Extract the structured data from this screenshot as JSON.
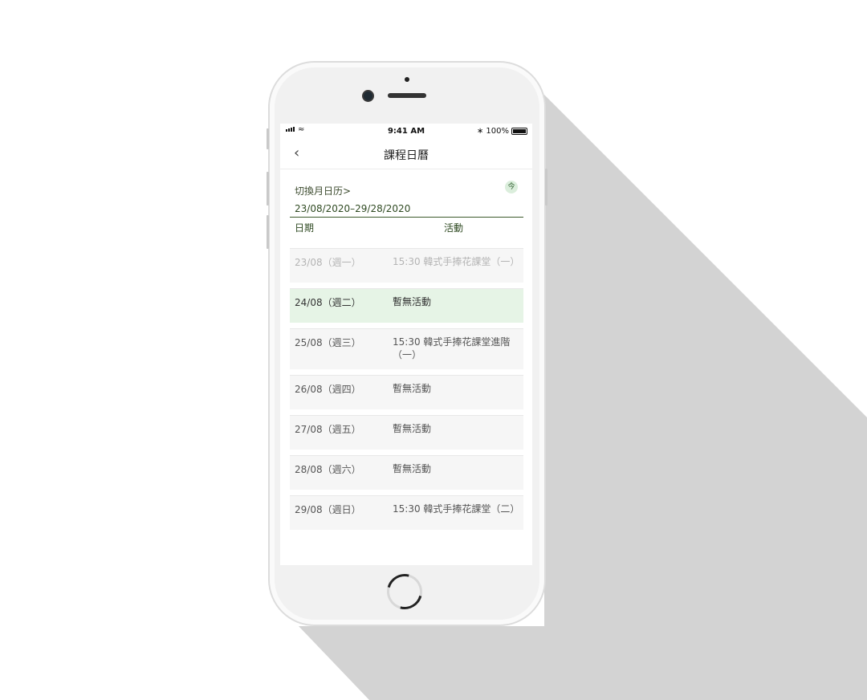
{
  "status": {
    "time": "9:41 AM",
    "battery": "100%"
  },
  "nav": {
    "back_icon": "chevron-left-icon",
    "title": "課程日曆"
  },
  "calendar": {
    "switch_label": "切換月日历>",
    "today_label": "今",
    "range": "23/08/2020–29/28/2020",
    "col_date": "日期",
    "col_activity": "活動"
  },
  "rows": [
    {
      "date": "23/08（週一）",
      "activity": "15:30 韓式手捧花課堂（一）"
    },
    {
      "date": "24/08（週二）",
      "activity": "暫無活動"
    },
    {
      "date": "25/08（週三）",
      "activity": "15:30 韓式手捧花課堂進階（一）"
    },
    {
      "date": "26/08（週四）",
      "activity": "暫無活動"
    },
    {
      "date": "27/08（週五）",
      "activity": "暫無活動"
    },
    {
      "date": "28/08（週六）",
      "activity": "暫無活動"
    },
    {
      "date": "29/08（週日）",
      "activity": "15:30 韓式手捧花課堂（二）"
    }
  ],
  "colors": {
    "accent": "#2f4a22",
    "highlight": "#e6f4e6",
    "shadow": "#d3d3d3"
  }
}
